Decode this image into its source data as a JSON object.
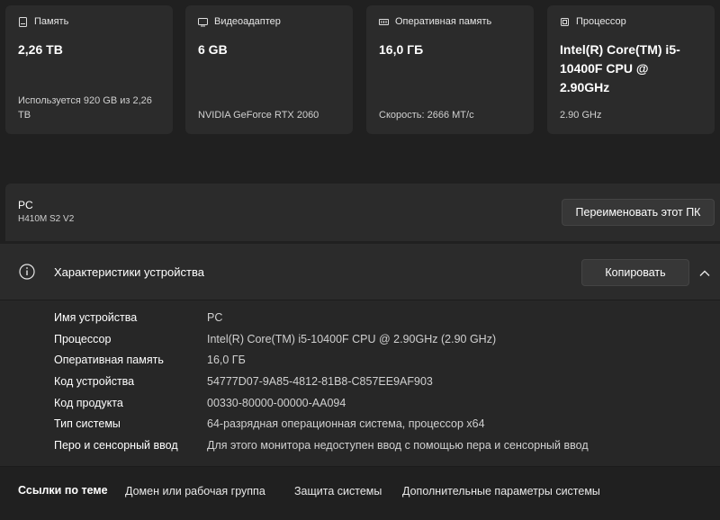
{
  "cards": [
    {
      "icon": "storage-icon",
      "title": "Память",
      "value": "2,26 TB",
      "sub": "Используется 920 GB из 2,26 TB"
    },
    {
      "icon": "gpu-icon",
      "title": "Видеоадаптер",
      "value": "6 GB",
      "sub": "NVIDIA GeForce RTX 2060"
    },
    {
      "icon": "ram-icon",
      "title": "Оперативная память",
      "value": "16,0 ГБ",
      "sub": "Скорость: 2666 MT/c"
    },
    {
      "icon": "cpu-icon",
      "title": "Процессор",
      "value": "Intel(R) Core(TM) i5-10400F CPU @ 2.90GHz",
      "sub": "2.90 GHz"
    }
  ],
  "pc": {
    "name": "PC",
    "model": "H410M S2 V2",
    "rename_label": "Переименовать этот ПК"
  },
  "specs": {
    "title": "Характеристики устройства",
    "copy_label": "Копировать",
    "rows": [
      {
        "key": "Имя устройства",
        "value": "PC"
      },
      {
        "key": "Процессор",
        "value": "Intel(R) Core(TM) i5-10400F CPU @ 2.90GHz (2.90 GHz)"
      },
      {
        "key": "Оперативная память",
        "value": "16,0 ГБ"
      },
      {
        "key": "Код устройства",
        "value": "54777D07-9A85-4812-81B8-C857EE9AF903"
      },
      {
        "key": "Код продукта",
        "value": "00330-80000-00000-AA094"
      },
      {
        "key": "Тип системы",
        "value": "64-разрядная операционная система, процессор x64"
      },
      {
        "key": "Перо и сенсорный ввод",
        "value": "Для этого монитора недоступен ввод с помощью пера и сенсорный ввод"
      }
    ]
  },
  "links": {
    "label": "Ссылки по теме",
    "items": [
      "Домен или рабочая группа",
      "Защита системы",
      "Дополнительные параметры системы"
    ]
  }
}
